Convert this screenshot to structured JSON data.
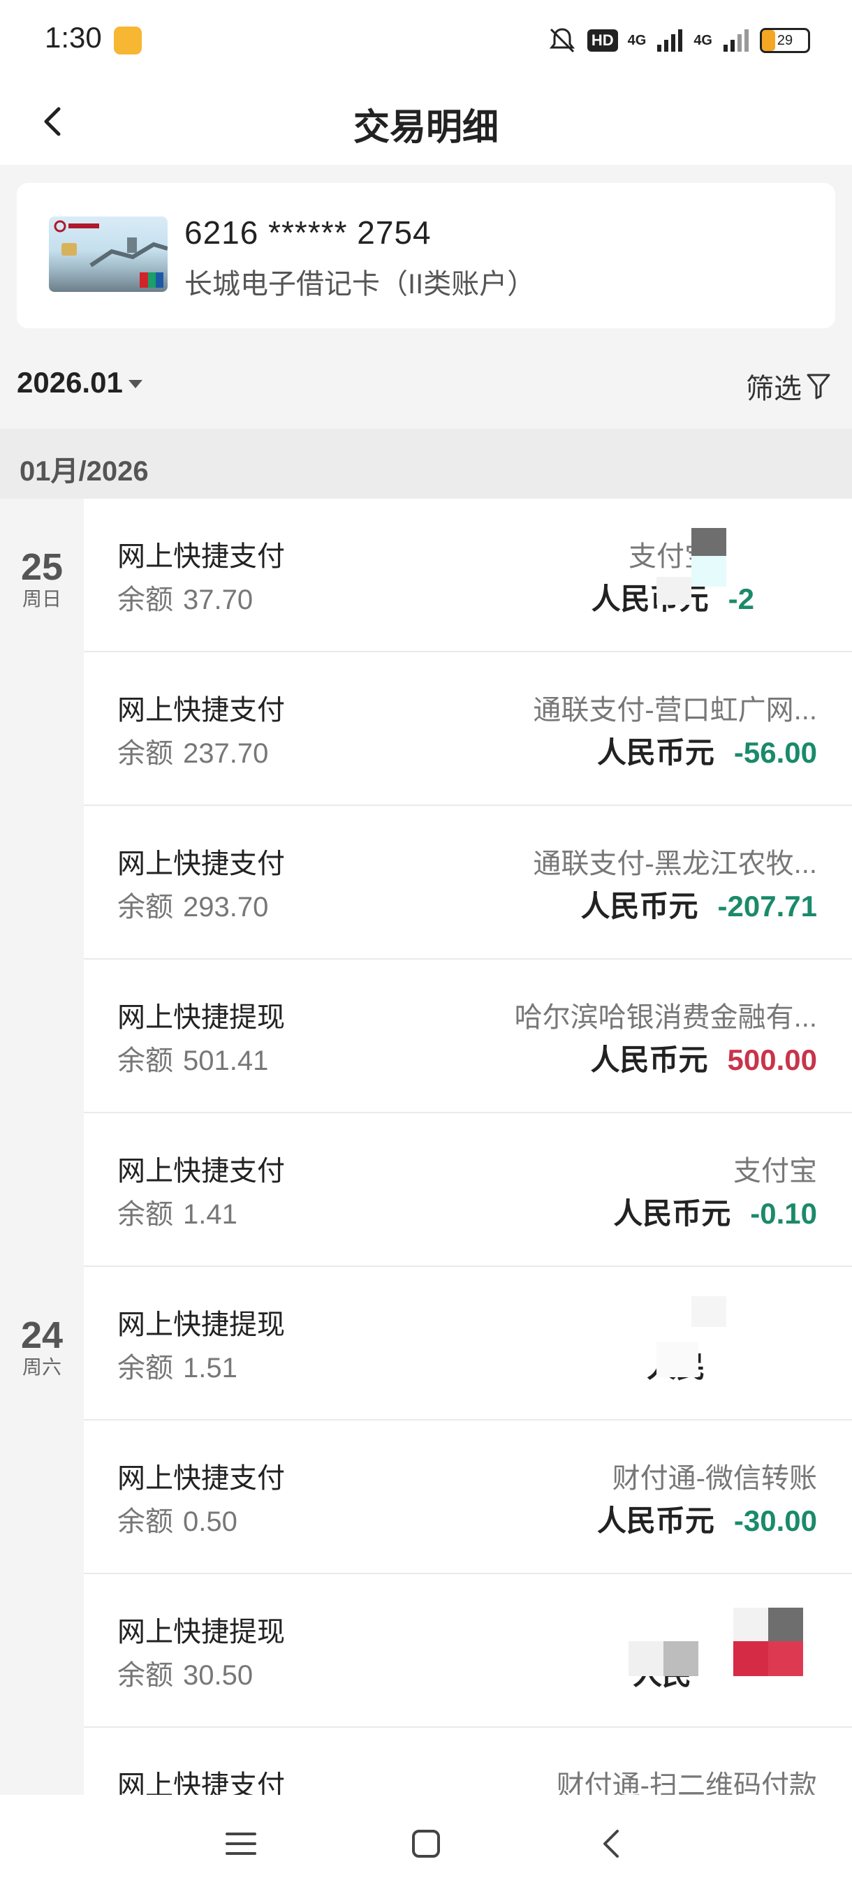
{
  "status_bar": {
    "time": "1:30",
    "hd": "HD",
    "signal1": "4G",
    "signal2": "4G",
    "battery": "29",
    "battery_level": 0.29
  },
  "header": {
    "title": "交易明细"
  },
  "card": {
    "number": "6216 ****** 2754",
    "type": "长城电子借记卡（II类账户）"
  },
  "filter_bar": {
    "month": "2026.01",
    "filter_label": "筛选"
  },
  "section": {
    "label": "01月/2026"
  },
  "days": [
    {
      "day": "25",
      "weekday": "周日"
    },
    {
      "day": "24",
      "weekday": "周六"
    }
  ],
  "transactions": [
    {
      "type": "网上快捷支付",
      "balance_label": "余额",
      "balance": "37.70",
      "merchant": "支付宝",
      "currency": "人民币元",
      "amount": "-2"
    },
    {
      "type": "网上快捷支付",
      "balance_label": "余额",
      "balance": "237.70",
      "merchant": "通联支付-营口虹广网...",
      "currency": "人民币元",
      "amount": "-56.00"
    },
    {
      "type": "网上快捷支付",
      "balance_label": "余额",
      "balance": "293.70",
      "merchant": "通联支付-黑龙江农牧...",
      "currency": "人民币元",
      "amount": "-207.71"
    },
    {
      "type": "网上快捷提现",
      "balance_label": "余额",
      "balance": "501.41",
      "merchant": "哈尔滨哈银消费金融有...",
      "currency": "人民币元",
      "amount": "500.00"
    },
    {
      "type": "网上快捷支付",
      "balance_label": "余额",
      "balance": "1.41",
      "merchant": "支付宝",
      "currency": "人民币元",
      "amount": "-0.10"
    },
    {
      "type": "网上快捷提现",
      "balance_label": "余额",
      "balance": "1.51",
      "merchant": "",
      "currency": "人民",
      "amount": ""
    },
    {
      "type": "网上快捷支付",
      "balance_label": "余额",
      "balance": "0.50",
      "merchant": "财付通-微信转账",
      "currency": "人民币元",
      "amount": "-30.00"
    },
    {
      "type": "网上快捷提现",
      "balance_label": "余额",
      "balance": "30.50",
      "merchant": "",
      "currency": "人民",
      "amount": ""
    },
    {
      "type": "网上快捷支付",
      "balance_label": "",
      "balance": "",
      "merchant": "财付通-扫二维码付款",
      "currency": "",
      "amount": ""
    }
  ]
}
